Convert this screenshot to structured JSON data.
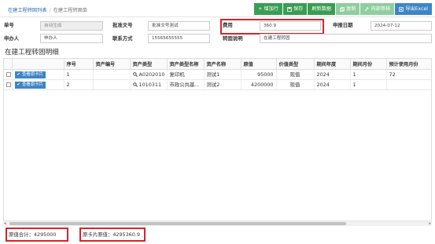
{
  "breadcrumb": {
    "parent": "在建工程转固列表",
    "separator": "/",
    "current": "在建工程转固单"
  },
  "toolbar": {
    "add_row": "增加行",
    "save": "保存",
    "refresh": "刷新数据",
    "copy": "复制",
    "internal_review": "内部审核",
    "export_excel": "导出Excel"
  },
  "form": {
    "doc_no_label": "单号",
    "doc_no_value": "自动生成",
    "approval_no_label": "批准文号",
    "approval_no_value": "批准文号测试",
    "cost_label": "费用",
    "cost_value": "360.9",
    "report_date_label": "申报日期",
    "report_date_value": "2024-07-12",
    "handler_label": "申办人",
    "handler_value": "申办人",
    "contact_label": "联系方式",
    "contact_value": "15565655555",
    "transfer_desc_label": "转固说明",
    "transfer_desc_value": "在建工程转固"
  },
  "section_title": "在建工程转固明细",
  "table": {
    "view_card_label": "查看原卡片",
    "columns": [
      "序号",
      "资产编号",
      "资产类型",
      "资产类型名称",
      "资产名称",
      "原值",
      "价值类型",
      "期间年度",
      "期间月份",
      "预计使用月份"
    ],
    "rows": [
      {
        "seq": "1",
        "asset_no": "",
        "asset_type": "A0202010",
        "asset_type_name": "复印机",
        "asset_name": "测试1",
        "original_value": "95000",
        "value_type": "现值",
        "year": "2024",
        "month": "1",
        "expected_months": "72"
      },
      {
        "seq": "2",
        "asset_no": "",
        "asset_type": "1010311",
        "asset_type_name": "市政公共基...",
        "asset_name": "测试2",
        "original_value": "4200000",
        "value_type": "现值",
        "year": "2024",
        "month": "1",
        "expected_months": ""
      }
    ]
  },
  "footer": {
    "original_total": "原值合计：4295000",
    "original_card_value": "原卡片原值：4295360.9"
  }
}
